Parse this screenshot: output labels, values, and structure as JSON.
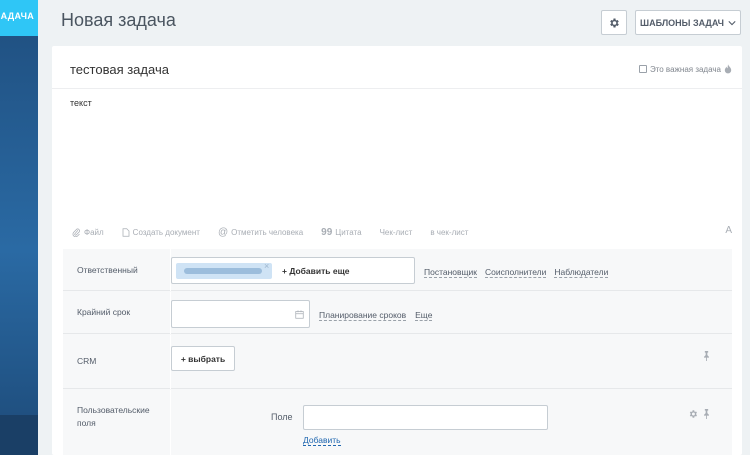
{
  "leftbar": {
    "strip_label": "ЗАДАЧА"
  },
  "header": {
    "title": "Новая задача",
    "templates_button": "ШАБЛОНЫ ЗАДАЧ"
  },
  "task": {
    "title": "тестовая задача",
    "important_label": "Это важная задача",
    "description": "текст"
  },
  "toolbar": {
    "file": "Файл",
    "create_doc": "Создать документ",
    "mention": "Отметить человека",
    "quote": "Цитата",
    "checklist": "Чек-лист",
    "to_checklist": "в чек-лист",
    "font_label": "A"
  },
  "fields": {
    "responsible": {
      "label": "Ответственный",
      "add_more": "+ Добавить еще",
      "links": [
        "Постановщик",
        "Соисполнители",
        "Наблюдатели"
      ]
    },
    "deadline": {
      "label": "Крайний срок",
      "links": [
        "Планирование сроков",
        "Еще"
      ]
    },
    "crm": {
      "label": "CRM",
      "button": "+ выбрать"
    },
    "user_fields": {
      "label_line1": "Пользовательские",
      "label_line2": "поля",
      "field_label": "Поле",
      "add_link": "Добавить"
    }
  },
  "colors": {
    "accent": "#2fc6f6",
    "sidebar": "#1f4e7e",
    "link": "#2067b0"
  }
}
